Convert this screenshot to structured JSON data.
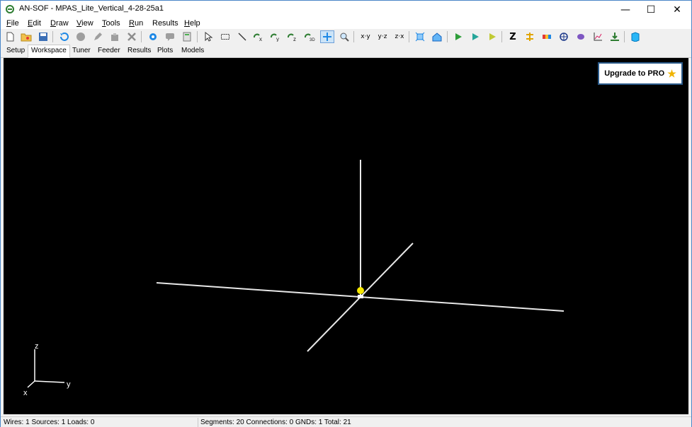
{
  "window": {
    "title": "AN-SOF - MPAS_Lite_Vertical_4-28-25a1"
  },
  "window_controls": {
    "minimize": "—",
    "maximize": "☐",
    "close": "✕"
  },
  "menu": [
    {
      "label": "File",
      "key": "F",
      "rest": "ile"
    },
    {
      "label": "Edit",
      "key": "E",
      "rest": "dit"
    },
    {
      "label": "Draw",
      "key": "D",
      "rest": "raw"
    },
    {
      "label": "View",
      "key": "V",
      "rest": "iew"
    },
    {
      "label": "Tools",
      "key": "T",
      "rest": "ools"
    },
    {
      "label": "Run",
      "key": "R",
      "rest": "un"
    },
    {
      "label": "Results",
      "key": "",
      "rest": "Results"
    },
    {
      "label": "Help",
      "key": "H",
      "rest": "elp"
    }
  ],
  "toolbar": {
    "xy_label": "x·y",
    "yz_label": "y·z",
    "zx_label": "z·x",
    "zin_label": "Z"
  },
  "tabs": [
    "Setup",
    "Workspace",
    "Tuner",
    "Feeder",
    "Results",
    "Plots",
    "Models"
  ],
  "active_tab": "Workspace",
  "upgrade": {
    "label": "Upgrade to PRO",
    "star": "★"
  },
  "axes": {
    "z": "z",
    "x": "x",
    "y": "y"
  },
  "status": {
    "left": "Wires: 1  Sources: 1  Loads: 0",
    "right": "Segments: 20  Connections: 0  GNDs: 1  Total: 21"
  }
}
